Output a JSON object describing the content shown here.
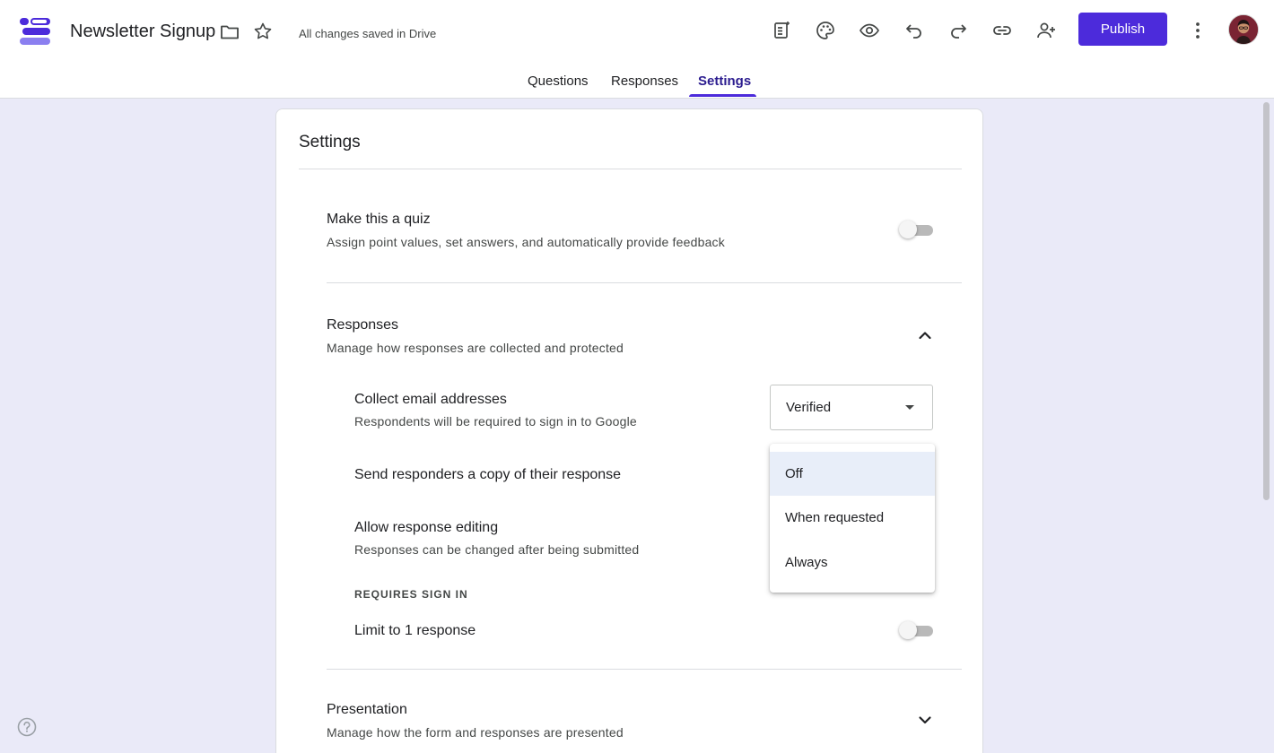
{
  "app": {
    "title": "Newsletter Signup",
    "save_status": "All changes saved in Drive",
    "publish_label": "Publish",
    "accent": "#4c2bdb"
  },
  "tabs": [
    {
      "label": "Questions"
    },
    {
      "label": "Responses"
    },
    {
      "label": "Settings",
      "active": true
    }
  ],
  "settings": {
    "title": "Settings",
    "quiz": {
      "title": "Make this a quiz",
      "desc": "Assign point values, set answers, and automatically provide feedback",
      "enabled": false
    },
    "responses": {
      "title": "Responses",
      "desc": "Manage how responses are collected and protected",
      "expanded": true,
      "collect_email": {
        "title": "Collect email addresses",
        "desc": "Respondents will be required to sign in to Google",
        "value": "Verified"
      },
      "send_copy": {
        "title": "Send responders a copy of their response",
        "options": [
          "Off",
          "When requested",
          "Always"
        ],
        "highlighted": "Off"
      },
      "editing": {
        "title": "Allow response editing",
        "desc": "Responses can be changed after being submitted"
      },
      "requires_sign_in": "REQUIRES SIGN IN",
      "limit": {
        "title": "Limit to 1 response",
        "enabled": false
      }
    },
    "presentation": {
      "title": "Presentation",
      "desc": "Manage how the form and responses are presented",
      "expanded": false
    }
  }
}
